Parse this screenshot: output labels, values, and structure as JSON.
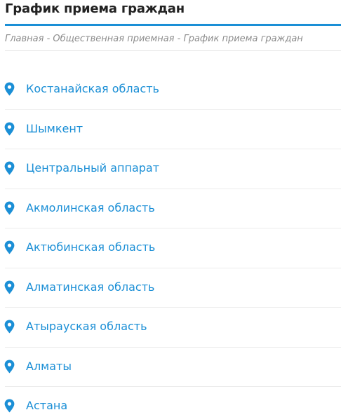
{
  "page": {
    "title": "График приема граждан",
    "breadcrumb": "Главная - Общественная приемная - График приема граждан",
    "accent_color": "#1b8fd6"
  },
  "regions": [
    {
      "label": "Костанайская область",
      "icon": "map-pin-icon"
    },
    {
      "label": "Шымкент",
      "icon": "map-pin-icon"
    },
    {
      "label": "Центральный аппарат",
      "icon": "map-pin-icon"
    },
    {
      "label": "Акмолинская область",
      "icon": "map-pin-icon"
    },
    {
      "label": "Актюбинская область",
      "icon": "map-pin-icon"
    },
    {
      "label": "Алматинская область",
      "icon": "map-pin-icon"
    },
    {
      "label": "Атырауская область",
      "icon": "map-pin-icon"
    },
    {
      "label": "Алматы",
      "icon": "map-pin-icon"
    },
    {
      "label": "Астана",
      "icon": "map-pin-icon"
    }
  ]
}
